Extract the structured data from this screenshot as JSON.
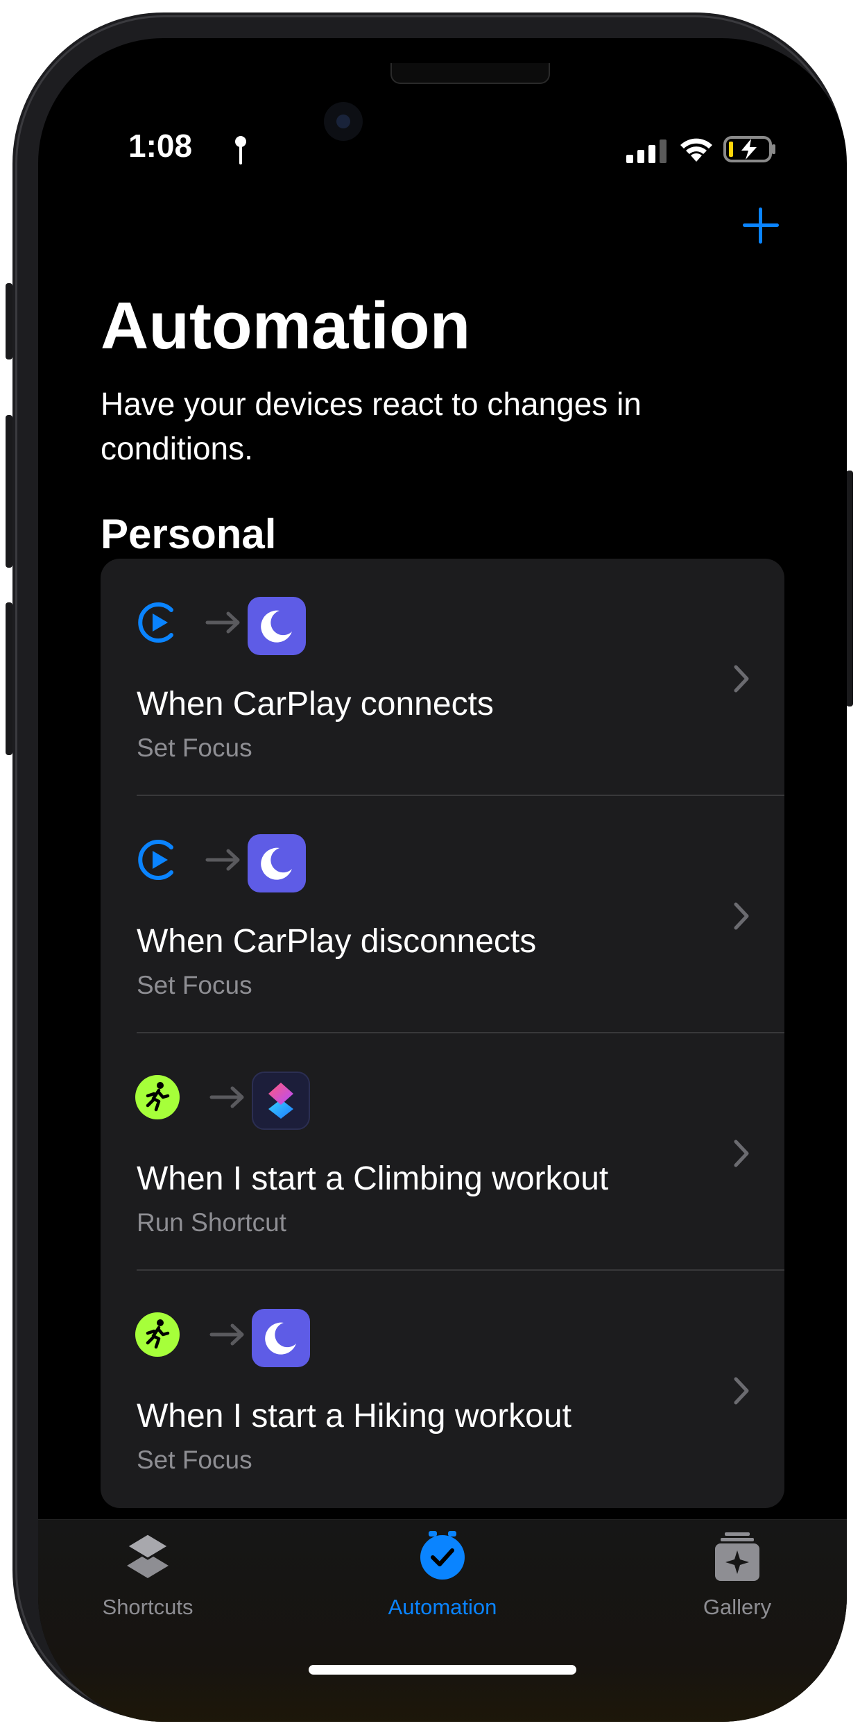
{
  "status_bar": {
    "time": "1:08"
  },
  "header": {
    "title": "Automation",
    "subtitle": "Have your devices react to changes in conditions."
  },
  "section": {
    "title": "Personal"
  },
  "automations": [
    {
      "trigger_icon": "carplay-icon",
      "action_icon": "focus-moon-icon",
      "title": "When CarPlay connects",
      "action": "Set Focus"
    },
    {
      "trigger_icon": "carplay-icon",
      "action_icon": "focus-moon-icon",
      "title": "When CarPlay disconnects",
      "action": "Set Focus"
    },
    {
      "trigger_icon": "workout-icon",
      "action_icon": "shortcuts-app-icon",
      "title": "When I start a Climbing workout",
      "action": "Run Shortcut"
    },
    {
      "trigger_icon": "workout-icon",
      "action_icon": "focus-moon-icon",
      "title": "When I start a Hiking workout",
      "action": "Set Focus"
    }
  ],
  "tabbar": {
    "tabs": [
      {
        "label": "Shortcuts",
        "icon": "shortcuts-stack-icon",
        "active": false
      },
      {
        "label": "Automation",
        "icon": "automation-clock-icon",
        "active": true
      },
      {
        "label": "Gallery",
        "icon": "gallery-icon",
        "active": false
      }
    ]
  },
  "colors": {
    "accent": "#0a84ff",
    "focus": "#5e5ce6",
    "workout": "#a6ff3a",
    "card": "#1c1c1e",
    "secondary_text": "#8e8e93"
  }
}
